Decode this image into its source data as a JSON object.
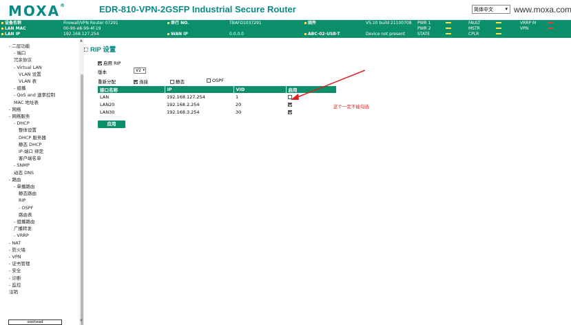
{
  "brand": {
    "logo_text": "MOXA",
    "registered": "®"
  },
  "header": {
    "device_title": "EDR-810-VPN-2GSFP Industrial Secure Router",
    "language": "简体中文",
    "site_url": "www.moxa.com"
  },
  "info_bar": {
    "device_name_label": "设备名称",
    "device_name_value": "Firewall/VPN Router 07291",
    "lan_mac_label": "LAN MAC",
    "lan_mac_value": "00-90-e8-99-4f-19",
    "lan_ip_label": "LAN IP",
    "lan_ip_value": "192.168.127.254",
    "serial_label": "串行 NO.",
    "serial_value": "TBAFD1037291",
    "wan_ip_label": "WAN IP",
    "wan_ip_value": "0.0.0.0",
    "firmware_label": "固件",
    "firmware_value": "V5.10 build 21100708",
    "abc_label": "ABC-02-USB-T",
    "abc_value": "Device not present",
    "status_labels": [
      "PWR 1",
      "PWR 2",
      "STATE",
      "FAULT",
      "MSTR",
      "CPLR",
      "VRRP M",
      "VPN"
    ]
  },
  "sidebar": {
    "items": [
      {
        "label": "- 二层功能",
        "indent": 0
      },
      {
        "label": "- 端口",
        "indent": 1
      },
      {
        "label": "冗余协议",
        "indent": 1
      },
      {
        "label": "- Virtual LAN",
        "indent": 1
      },
      {
        "label": "VLAN 设置",
        "indent": 2
      },
      {
        "label": "VLAN 表",
        "indent": 2
      },
      {
        "label": "- 组播",
        "indent": 1
      },
      {
        "label": "- QoS and 速率控制",
        "indent": 1
      },
      {
        "label": "MAC 地址表",
        "indent": 1
      },
      {
        "label": "- 网络",
        "indent": 0
      },
      {
        "label": "- 网络服务",
        "indent": 0
      },
      {
        "label": "- DHCP",
        "indent": 1
      },
      {
        "label": "整体设置",
        "indent": 2
      },
      {
        "label": "DHCP 服务器",
        "indent": 2
      },
      {
        "label": "静态 DHCP",
        "indent": 2
      },
      {
        "label": "IP-端口 绑定",
        "indent": 2
      },
      {
        "label": "客户端名单",
        "indent": 2
      },
      {
        "label": "- SNMP",
        "indent": 1
      },
      {
        "label": "动态 DNS",
        "indent": 1
      },
      {
        "label": "- 路由",
        "indent": 0
      },
      {
        "label": "- 单播路由",
        "indent": 1
      },
      {
        "label": "静态路由",
        "indent": 2
      },
      {
        "label": "RIP",
        "indent": 2
      },
      {
        "label": "- OSPF",
        "indent": 2
      },
      {
        "label": "路由表",
        "indent": 2
      },
      {
        "label": "- 组播路由",
        "indent": 1
      },
      {
        "label": "广播转发",
        "indent": 1
      },
      {
        "label": "- VRRP",
        "indent": 1
      },
      {
        "label": "- NAT",
        "indent": 0
      },
      {
        "label": "- 防火墙",
        "indent": 0
      },
      {
        "label": "- VPN",
        "indent": 0
      },
      {
        "label": "- 证书管理",
        "indent": 0
      },
      {
        "label": "- 安全",
        "indent": 0
      },
      {
        "label": "- 诊断",
        "indent": 0
      },
      {
        "label": "- 监控",
        "indent": 0
      },
      {
        "label": "注销",
        "indent": 0
      }
    ],
    "bottom_button": "ooshead"
  },
  "main": {
    "page_title": "RIP 设置",
    "enable_rip_label": "启用 RIP",
    "enable_rip_checked": true,
    "version_label": "版本",
    "version_value": "V2",
    "redistribute_label": "重新分配",
    "redistribute_options": [
      {
        "label": "连接",
        "checked": true
      },
      {
        "label": "静态",
        "checked": false
      },
      {
        "label": "OSPF",
        "checked": false
      }
    ],
    "table": {
      "headers": [
        "接口名称",
        "IP",
        "VID",
        "启用"
      ],
      "rows": [
        {
          "name": "LAN",
          "ip": "192.168.127.254",
          "vid": "1",
          "enabled": false
        },
        {
          "name": "LAN20",
          "ip": "192.168.2.254",
          "vid": "20",
          "enabled": true
        },
        {
          "name": "LAN30",
          "ip": "192.168.3.254",
          "vid": "30",
          "enabled": true
        }
      ]
    },
    "apply_label": "应用",
    "annotation": "这个一定不能勾选",
    "annotation_color": "#e02020"
  },
  "colors": {
    "accent": "#0b8f6a",
    "brand": "#0a8a86"
  }
}
